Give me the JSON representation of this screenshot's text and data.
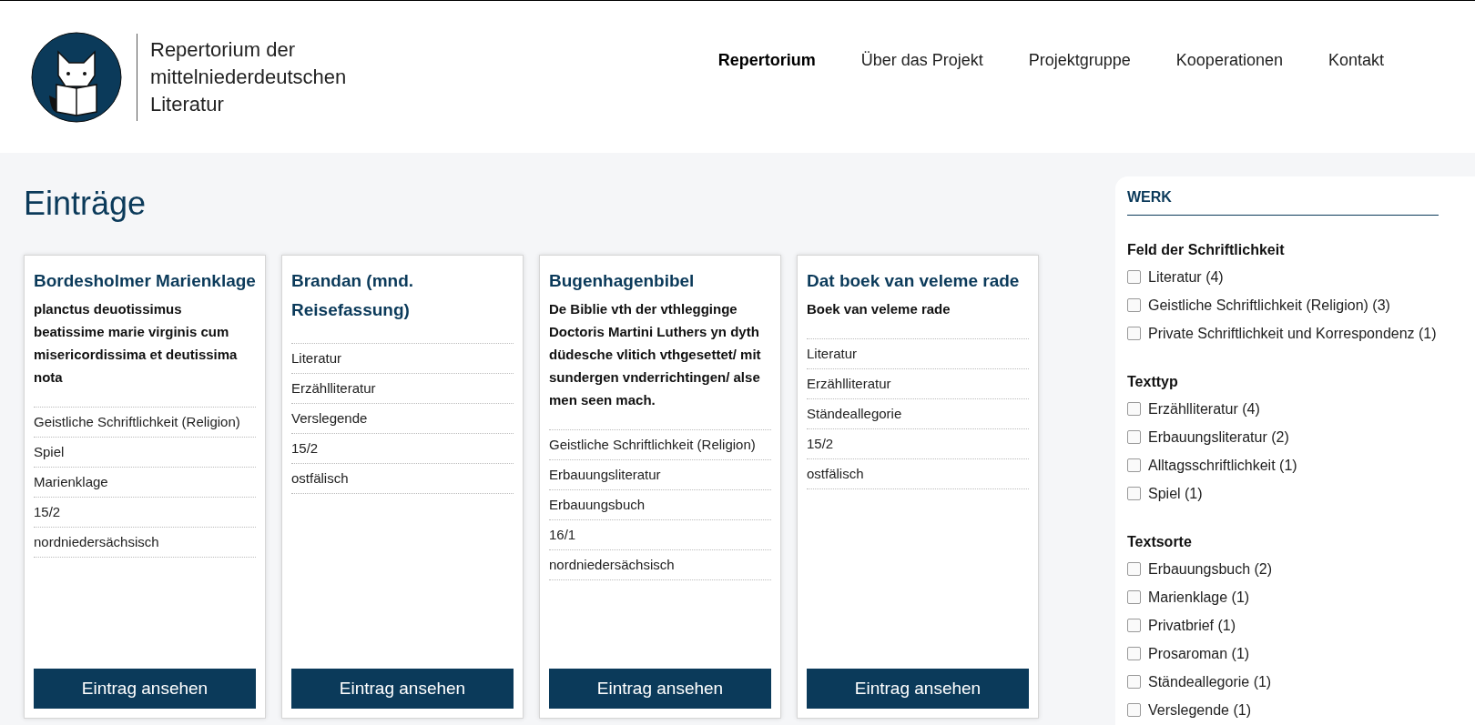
{
  "header": {
    "logo_title": "Repertorium der mittelniederdeutschen Literatur",
    "nav": [
      {
        "label": "Repertorium",
        "selected": true
      },
      {
        "label": "Über das Projekt",
        "selected": false
      },
      {
        "label": "Projektgruppe",
        "selected": false
      },
      {
        "label": "Kooperationen",
        "selected": false
      },
      {
        "label": "Kontakt",
        "selected": false
      }
    ]
  },
  "page_title": "Einträge",
  "cards": [
    {
      "title": "Bordesholmer Marienklage",
      "subtitle": "planctus deuotissimus beatissime marie virginis cum misericordissima et deutissima nota",
      "fields": [
        "Geistliche Schriftlichkeit (Religion)",
        "Spiel",
        "Marienklage",
        "15/2",
        "nordniedersächsisch"
      ],
      "button": "Eintrag ansehen"
    },
    {
      "title": "Brandan (mnd. Reisefassung)",
      "fields": [
        "Literatur",
        "Erzählliteratur",
        "Verslegende",
        "15/2",
        "ostfälisch"
      ],
      "button": "Eintrag ansehen"
    },
    {
      "title": "Bugenhagenbibel",
      "subtitle": "De Biblie vth der vthlegginge Doctoris Martini Luthers yn dyth düdesche vlitich vthgesettet/ mit sundergen vnderrichtingen/ alse men seen mach.",
      "fields": [
        "Geistliche Schriftlichkeit (Religion)",
        "Erbauungsliteratur",
        "Erbauungsbuch",
        "16/1",
        "nordniedersächsisch"
      ],
      "button": "Eintrag ansehen"
    },
    {
      "title": "Dat boek van veleme rade",
      "subtitle": "Boek van veleme rade",
      "fields": [
        "Literatur",
        "Erzählliteratur",
        "Ständeallegorie",
        "15/2",
        "ostfälisch"
      ],
      "button": "Eintrag ansehen"
    }
  ],
  "sidebar": {
    "heading": "WERK",
    "groups": [
      {
        "title": "Feld der Schriftlichkeit",
        "options": [
          {
            "label": "Literatur (4)",
            "checked": false
          },
          {
            "label": "Geistliche Schriftlichkeit (Religion) (3)",
            "checked": false
          },
          {
            "label": "Private Schriftlichkeit und Korrespondenz (1)",
            "checked": false
          }
        ]
      },
      {
        "title": "Texttyp",
        "options": [
          {
            "label": "Erzählliteratur (4)",
            "checked": false
          },
          {
            "label": "Erbauungsliteratur (2)",
            "checked": false
          },
          {
            "label": "Alltagsschriftlichkeit (1)",
            "checked": false
          },
          {
            "label": "Spiel (1)",
            "checked": false
          }
        ]
      },
      {
        "title": "Textsorte",
        "options": [
          {
            "label": "Erbauungsbuch (2)",
            "checked": false
          },
          {
            "label": "Marienklage (1)",
            "checked": false
          },
          {
            "label": "Privatbrief (1)",
            "checked": false
          },
          {
            "label": "Prosaroman (1)",
            "checked": false
          },
          {
            "label": "Ständeallegorie (1)",
            "checked": false
          },
          {
            "label": "Verslegende (1)",
            "checked": false
          }
        ]
      }
    ]
  }
}
